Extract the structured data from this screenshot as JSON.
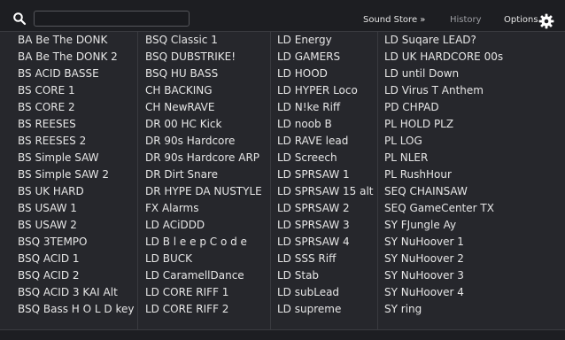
{
  "toolbar": {
    "search_value": "",
    "search_placeholder": "",
    "sound_store_label": "Sound Store »",
    "history_label": "History",
    "options_label": "Options"
  },
  "preset_columns": [
    {
      "items": [
        "BA Be The DONK",
        "BA Be The DONK 2",
        "BS ACID BASSE",
        "BS CORE 1",
        "BS CORE 2",
        "BS REESES",
        "BS REESES 2",
        "BS Simple SAW",
        "BS Simple SAW 2",
        "BS UK HARD",
        "BS USAW 1",
        "BS USAW 2",
        "BSQ 3TEMPO",
        "BSQ ACID 1",
        "BSQ ACID 2",
        "BSQ ACID 3 KAI Alt",
        "BSQ Bass H O L D key"
      ]
    },
    {
      "items": [
        "BSQ Classic 1",
        "BSQ DUBSTRIKE!",
        "BSQ HU BASS",
        "CH BACKING",
        "CH NewRAVE",
        "DR 00 HC Kick",
        "DR 90s Hardcore",
        "DR 90s Hardcore ARP",
        "DR Dirt Snare",
        "DR HYPE DA NUSTYLE",
        "FX  Alarms",
        "LD ACiDDD",
        "LD B l e e p C o d e",
        "LD BUCK",
        "LD CaramellDance",
        "LD CORE RIFF 1",
        "LD CORE RIFF 2"
      ]
    },
    {
      "items": [
        "LD Energy",
        "LD GAMERS",
        "LD HOOD",
        "LD HYPER Loco",
        "LD N!ke Riff",
        "LD noob B",
        "LD RAVE lead",
        "LD Screech",
        "LD SPRSAW 1",
        "LD SPRSAW 15 alt",
        "LD SPRSAW 2",
        "LD SPRSAW 3",
        "LD SPRSAW 4",
        "LD SSS Riff",
        "LD Stab",
        "LD subLead",
        "LD supreme"
      ]
    },
    {
      "items": [
        "LD Suqare LEAD?",
        "LD UK HARDCORE 00s",
        "LD until Down",
        "LD Virus T Anthem",
        "PD CHPAD",
        "PL HOLD PLZ",
        "PL LOG",
        "PL NLER",
        "PL RushHour",
        "SEQ CHAINSAW",
        "SEQ GameCenter TX",
        "SY FJungle Ay",
        "SY NuHoover 1",
        "SY NuHoover 2",
        "SY NuHoover 3",
        "SY NuHoover 4",
        "SY ring"
      ]
    }
  ],
  "colors": {
    "background": "#26272c",
    "toolbar": "#1d1e22",
    "text": "#e6e6e6",
    "muted_text": "#9d9ea3",
    "separator": "#3a3b40"
  },
  "icons": {
    "search": "search-icon",
    "options": "gear-icon"
  }
}
